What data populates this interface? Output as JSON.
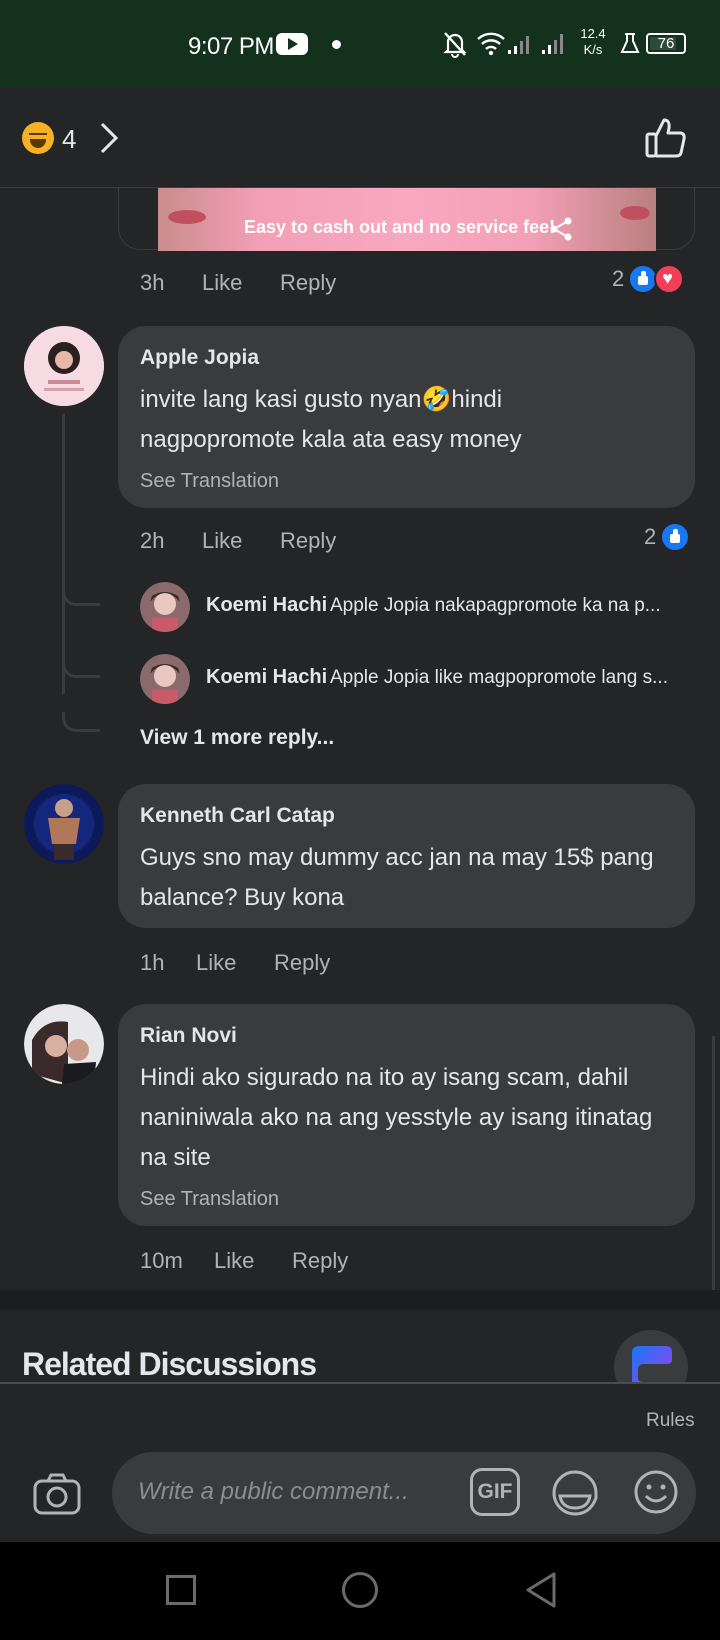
{
  "status_bar": {
    "time": "9:07 PM",
    "net_speed_value": "12.4",
    "net_speed_unit": "K/s",
    "battery": "76"
  },
  "header": {
    "reaction_count": "4"
  },
  "ad": {
    "text": "Easy to cash out and no service fee!"
  },
  "ad_meta": {
    "time": "3h",
    "like": "Like",
    "reply": "Reply",
    "reaction_count": "2"
  },
  "comments": [
    {
      "name": "Apple Jopia",
      "text_line1": "invite lang kasi gusto nyan🤣hindi",
      "text_line2": "nagpopromote kala ata easy money",
      "see_translation": "See Translation",
      "time": "2h",
      "like": "Like",
      "reply": "Reply",
      "reaction_count": "2"
    },
    {
      "name": "Kenneth Carl Catap",
      "text_line1": "Guys sno may dummy acc jan na may 15$ pang",
      "text_line2": "balance? Buy kona",
      "time": "1h",
      "like": "Like",
      "reply": "Reply"
    },
    {
      "name": "Rian Novi",
      "text_line1": "Hindi ako sigurado na ito ay isang scam, dahil",
      "text_line2": "naniniwala ako na ang yesstyle ay isang itinatag",
      "text_line3": "na site",
      "see_translation": "See Translation",
      "time": "10m",
      "like": "Like",
      "reply": "Reply"
    }
  ],
  "replies": [
    {
      "name": "Koemi Hachi",
      "text": "Apple Jopia nakapagpromote ka na p..."
    },
    {
      "name": "Koemi Hachi",
      "text": "Apple Jopia like magpopromote lang s..."
    }
  ],
  "view_more": "View 1 more reply...",
  "related": "Related Discussions",
  "composer": {
    "rules": "Rules",
    "placeholder": "Write a public comment...",
    "gif": "GIF"
  },
  "colors": {
    "background": "#242527",
    "bubble": "#3a3b3c",
    "status_bar": "#13311c",
    "like_blue": "#1877f2",
    "love_red": "#f33e58"
  }
}
